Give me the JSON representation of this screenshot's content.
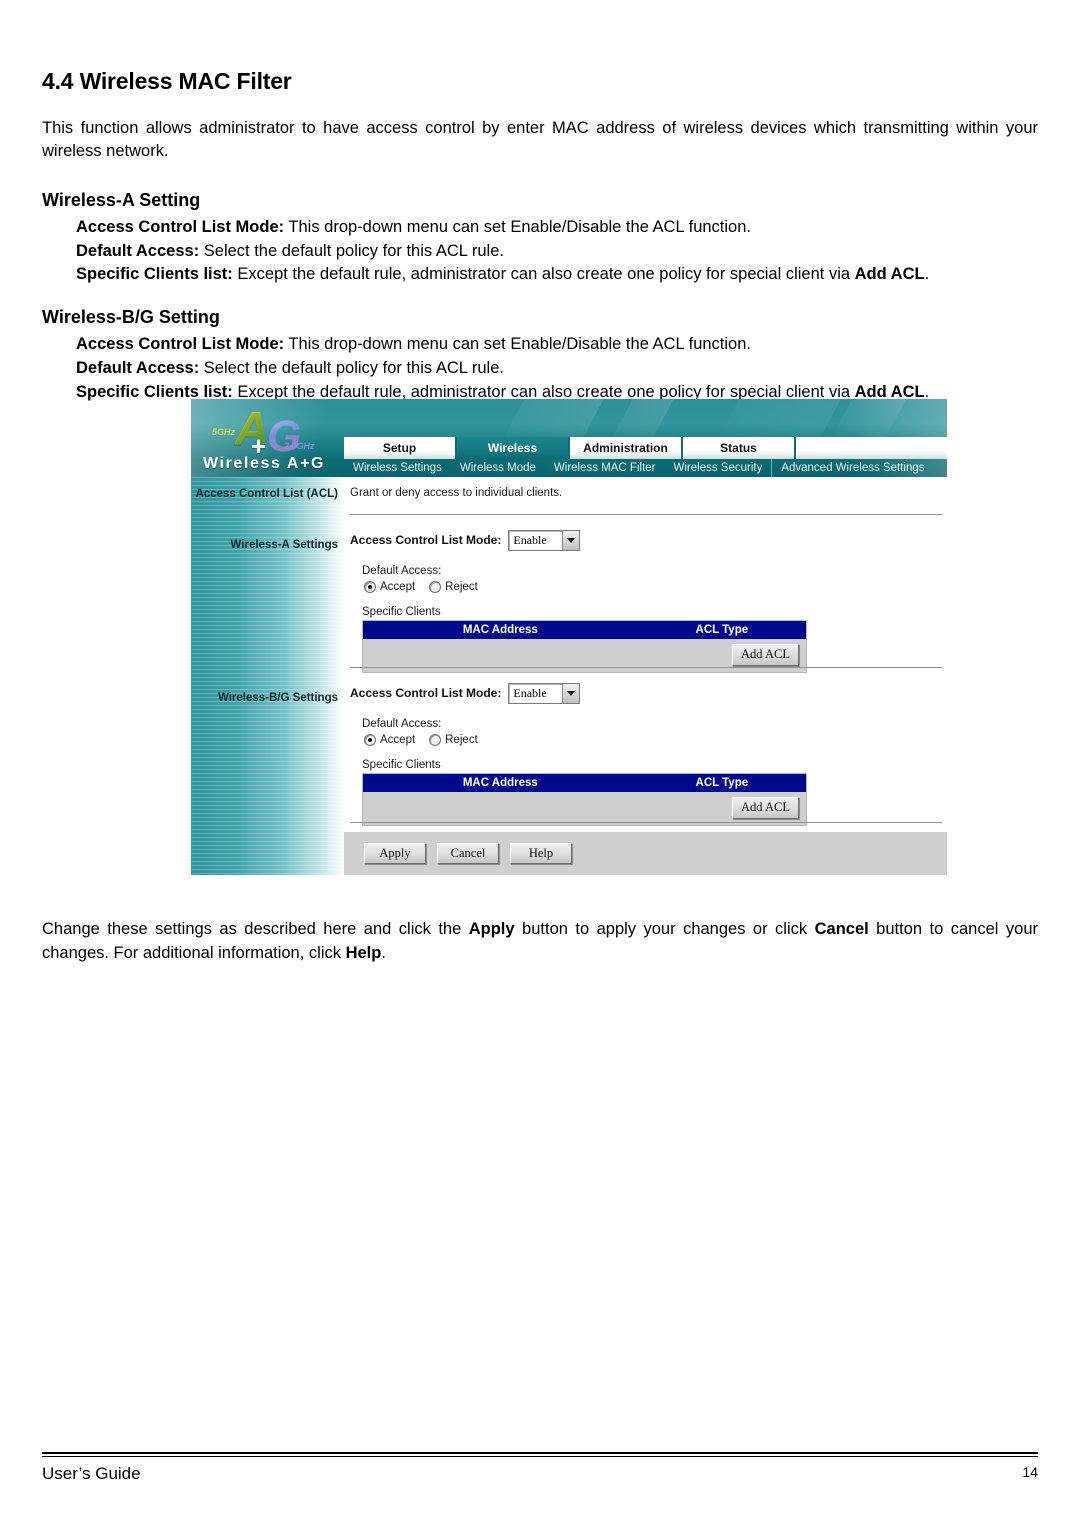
{
  "document": {
    "section_number": "4.4",
    "section_title": "4.4 Wireless MAC Filter",
    "intro": "This function allows administrator to have access control by enter MAC address of wireless devices which transmitting within your wireless network.",
    "wireless_a": {
      "heading": "Wireless-A Setting",
      "items": [
        {
          "term": "Access Control List Mode:",
          "text": " This drop-down menu can set Enable/Disable the ACL function."
        },
        {
          "term": "Default Access:",
          "text": " Select the default policy for this ACL rule."
        },
        {
          "term": "Specific Clients list:",
          "text": " Except the default rule, administrator can also create one policy for special client via ",
          "term2": "Add ACL",
          "text2": "."
        }
      ]
    },
    "wireless_bg": {
      "heading": "Wireless-B/G Setting",
      "items": [
        {
          "term": "Access Control List Mode:",
          "text": " This drop-down menu can set Enable/Disable the ACL function."
        },
        {
          "term": "Default Access:",
          "text": " Select the default policy for this ACL rule."
        },
        {
          "term": "Specific Clients list:",
          "text": " Except the default rule, administrator can also create one policy for special client via ",
          "term2": "Add ACL",
          "text2": "."
        }
      ]
    },
    "outro": {
      "part1": "Change these settings as described here and click the ",
      "bold1": "Apply",
      "part2": " button to apply your changes or click ",
      "bold2": "Cancel",
      "part3": " button to cancel your changes. For additional information, click ",
      "bold3": "Help",
      "part4": "."
    },
    "footer": {
      "left": "User’s Guide",
      "page": "14"
    }
  },
  "screenshot": {
    "logo": {
      "glyph_a": "A",
      "glyph_g": "G",
      "glyph_plus": "+",
      "tag_5ghz": "5GHz",
      "tag_24ghz": "2.4GHz",
      "wordmark": "Wireless A+G"
    },
    "tabs": [
      {
        "label": "Setup",
        "active": false
      },
      {
        "label": "Wireless",
        "active": true
      },
      {
        "label": "Administration",
        "active": false
      },
      {
        "label": "Status",
        "active": false
      }
    ],
    "subtabs": [
      {
        "label": "Wireless Settings"
      },
      {
        "label": "Wireless Mode"
      },
      {
        "label": "Wireless MAC Filter"
      },
      {
        "label": "Wireless Security"
      },
      {
        "label": "Advanced Wireless Settings"
      }
    ],
    "acl": {
      "side_label": "Access Control List (ACL)",
      "description": "Grant or deny access to individual clients."
    },
    "wireless_a_panel": {
      "side_label": "Wireless-A Settings",
      "mode_label": "Access Control List Mode:",
      "mode_value": "Enable",
      "default_access_label": "Default Access:",
      "radio_accept": "Accept",
      "radio_reject": "Reject",
      "selected_radio": "Accept",
      "specific_clients_label": "Specific Clients",
      "table_headers": [
        "MAC Address",
        "ACL Type"
      ],
      "rows": [],
      "add_button": "Add ACL"
    },
    "wireless_bg_panel": {
      "side_label": "Wireless-B/G Settings",
      "mode_label": "Access Control List Mode:",
      "mode_value": "Enable",
      "default_access_label": "Default Access:",
      "radio_accept": "Accept",
      "radio_reject": "Reject",
      "selected_radio": "Accept",
      "specific_clients_label": "Specific Clients",
      "table_headers": [
        "MAC Address",
        "ACL Type"
      ],
      "rows": [],
      "add_button": "Add ACL"
    },
    "actions": {
      "apply": "Apply",
      "cancel": "Cancel",
      "help": "Help"
    },
    "colors": {
      "banner_teal": "#0c6b74",
      "sidebar_teal": "#3fa3ab",
      "table_header_navy": "#000a8c",
      "panel_grey": "#cfcfcf"
    }
  }
}
